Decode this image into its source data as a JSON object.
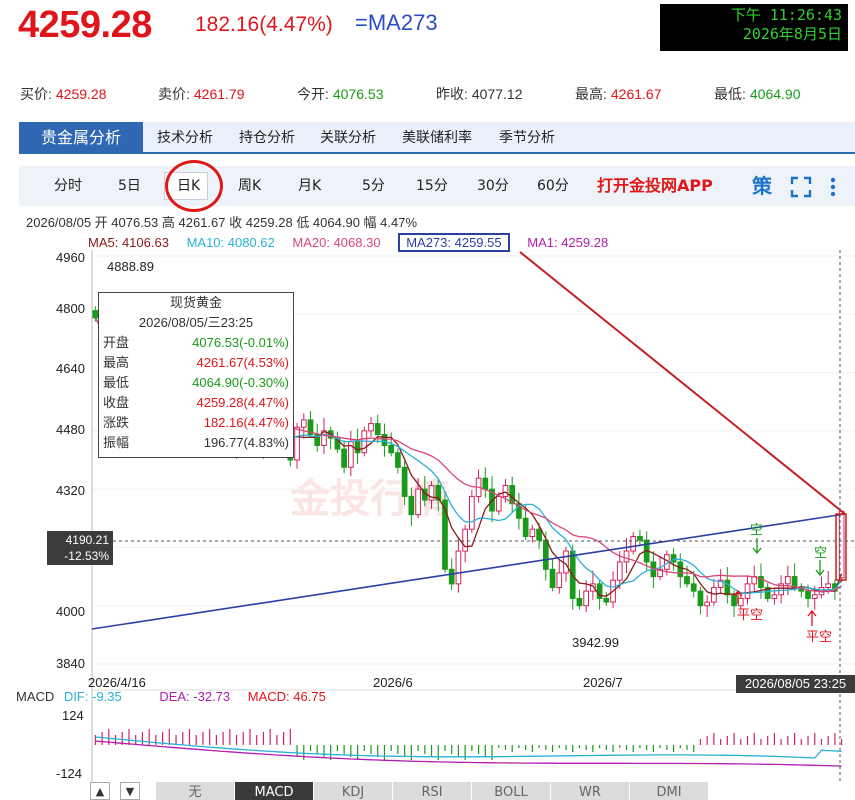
{
  "header": {
    "price": "4259.28",
    "change": "182.16(4.47%)",
    "ma_label": "=MA273",
    "clock_line1": "下午 11:26:43",
    "clock_line2": "2026年8月5日"
  },
  "quotes": [
    {
      "label": "买价:",
      "value": "4259.28",
      "color": "#e0151b"
    },
    {
      "label": "卖价:",
      "value": "4261.79",
      "color": "#e0151b"
    },
    {
      "label": "今开:",
      "value": "4076.53",
      "color": "#1a9a1a"
    },
    {
      "label": "昨收:",
      "value": "4077.12",
      "color": "#333333"
    },
    {
      "label": "最高:",
      "value": "4261.67",
      "color": "#e0151b"
    },
    {
      "label": "最低:",
      "value": "4064.90",
      "color": "#1a9a1a"
    }
  ],
  "section_nav": {
    "active": "贵金属分析",
    "items": [
      "技术分析",
      "持仓分析",
      "关联分析",
      "美联储利率",
      "季节分析"
    ]
  },
  "periods": [
    "分时",
    "5日",
    "日K",
    "周K",
    "月K",
    "5分",
    "15分",
    "30分",
    "60分"
  ],
  "app_link": "打开金投网APP",
  "ohlc_summary": "2026/08/05  开 4076.53  高 4261.67  收 4259.28  低 4064.90  幅 4.47%",
  "ma_legend": [
    {
      "text": "MA5: 4106.63",
      "color": "#8b1a1a"
    },
    {
      "text": "MA10: 4080.62",
      "color": "#2ab0d6"
    },
    {
      "text": "MA20: 4068.30",
      "color": "#d9467a"
    },
    {
      "text": "MA273: 4259.55",
      "color": "#2b3fa5"
    },
    {
      "text": "MA1: 4259.28",
      "color": "#b01fb0"
    }
  ],
  "y_ticks": [
    "4960",
    "4800",
    "4640",
    "4480",
    "4320",
    "4160",
    "4000",
    "3840"
  ],
  "x_ticks": [
    "2026/4/16",
    "2026/6",
    "2026/7"
  ],
  "crosshair": {
    "price": "4190.21",
    "pct": "-12.53%",
    "date": "2026/08/05 23:25"
  },
  "annotations": {
    "high": "4888.89",
    "low": "3942.99",
    "sell1": "空",
    "sell2": "空",
    "cover1": "平空",
    "cover2": "平空"
  },
  "watermark": "金投行情",
  "tooltip": {
    "title": "现货黄金",
    "datetime": "2026/08/05/三23:25",
    "rows": [
      {
        "k": "开盘",
        "v": "4076.53(-0.01%)",
        "color": "#1a9a1a"
      },
      {
        "k": "最高",
        "v": "4261.67(4.53%)",
        "color": "#e0151b"
      },
      {
        "k": "最低",
        "v": "4064.90(-0.30%)",
        "color": "#1a9a1a"
      },
      {
        "k": "收盘",
        "v": "4259.28(4.47%)",
        "color": "#e0151b"
      },
      {
        "k": "涨跌",
        "v": "182.16(4.47%)",
        "color": "#e0151b"
      },
      {
        "k": "振幅",
        "v": "196.77(4.83%)",
        "color": "#222222"
      }
    ]
  },
  "macd": {
    "label": "MACD",
    "dif": "DIF: -9.35",
    "dea": "DEA: -32.73",
    "macd": "MACD: 46.75",
    "y_top": "124",
    "y_bottom": "-124"
  },
  "indicator_tabs": [
    "无",
    "MACD",
    "KDJ",
    "RSI",
    "BOLL",
    "WR",
    "DMI"
  ],
  "chart_data": {
    "type": "candlestick",
    "y_range": [
      3840,
      4960
    ],
    "x_labels": [
      "2026/4/16",
      "2026/6",
      "2026/7"
    ],
    "latest": {
      "date": "2026/08/05",
      "open": 4076.53,
      "high": 4261.67,
      "low": 4064.9,
      "close": 4259.28
    },
    "closes_approx": [
      4790,
      4720,
      4700,
      4760,
      4640,
      4690,
      4620,
      4660,
      4600,
      4560,
      4540,
      4600,
      4550,
      4520,
      4560,
      4500,
      4480,
      4460,
      4500,
      4450,
      4420,
      4470,
      4500,
      4460,
      4420,
      4480,
      4520,
      4470,
      4440,
      4400,
      4490,
      4510,
      4470,
      4440,
      4480,
      4460,
      4430,
      4380,
      4450,
      4420,
      4480,
      4500,
      4470,
      4440,
      4420,
      4380,
      4300,
      4250,
      4320,
      4290,
      4330,
      4290,
      4100,
      4060,
      4150,
      4210,
      4300,
      4350,
      4320,
      4260,
      4300,
      4330,
      4280,
      4240,
      4190,
      4210,
      4180,
      4100,
      4050,
      4090,
      4150,
      4020,
      4000,
      4040,
      4060,
      4020,
      4010,
      4070,
      4120,
      4150,
      4190,
      4180,
      4120,
      4080,
      4100,
      4140,
      4120,
      4080,
      4060,
      4040,
      4000,
      4010,
      4050,
      4070,
      4030,
      4000,
      4020,
      4060,
      4080,
      4050,
      4020,
      4030,
      4060,
      4080,
      4050,
      4040,
      4020,
      4030,
      4050,
      4060,
      4040,
      4259
    ]
  }
}
